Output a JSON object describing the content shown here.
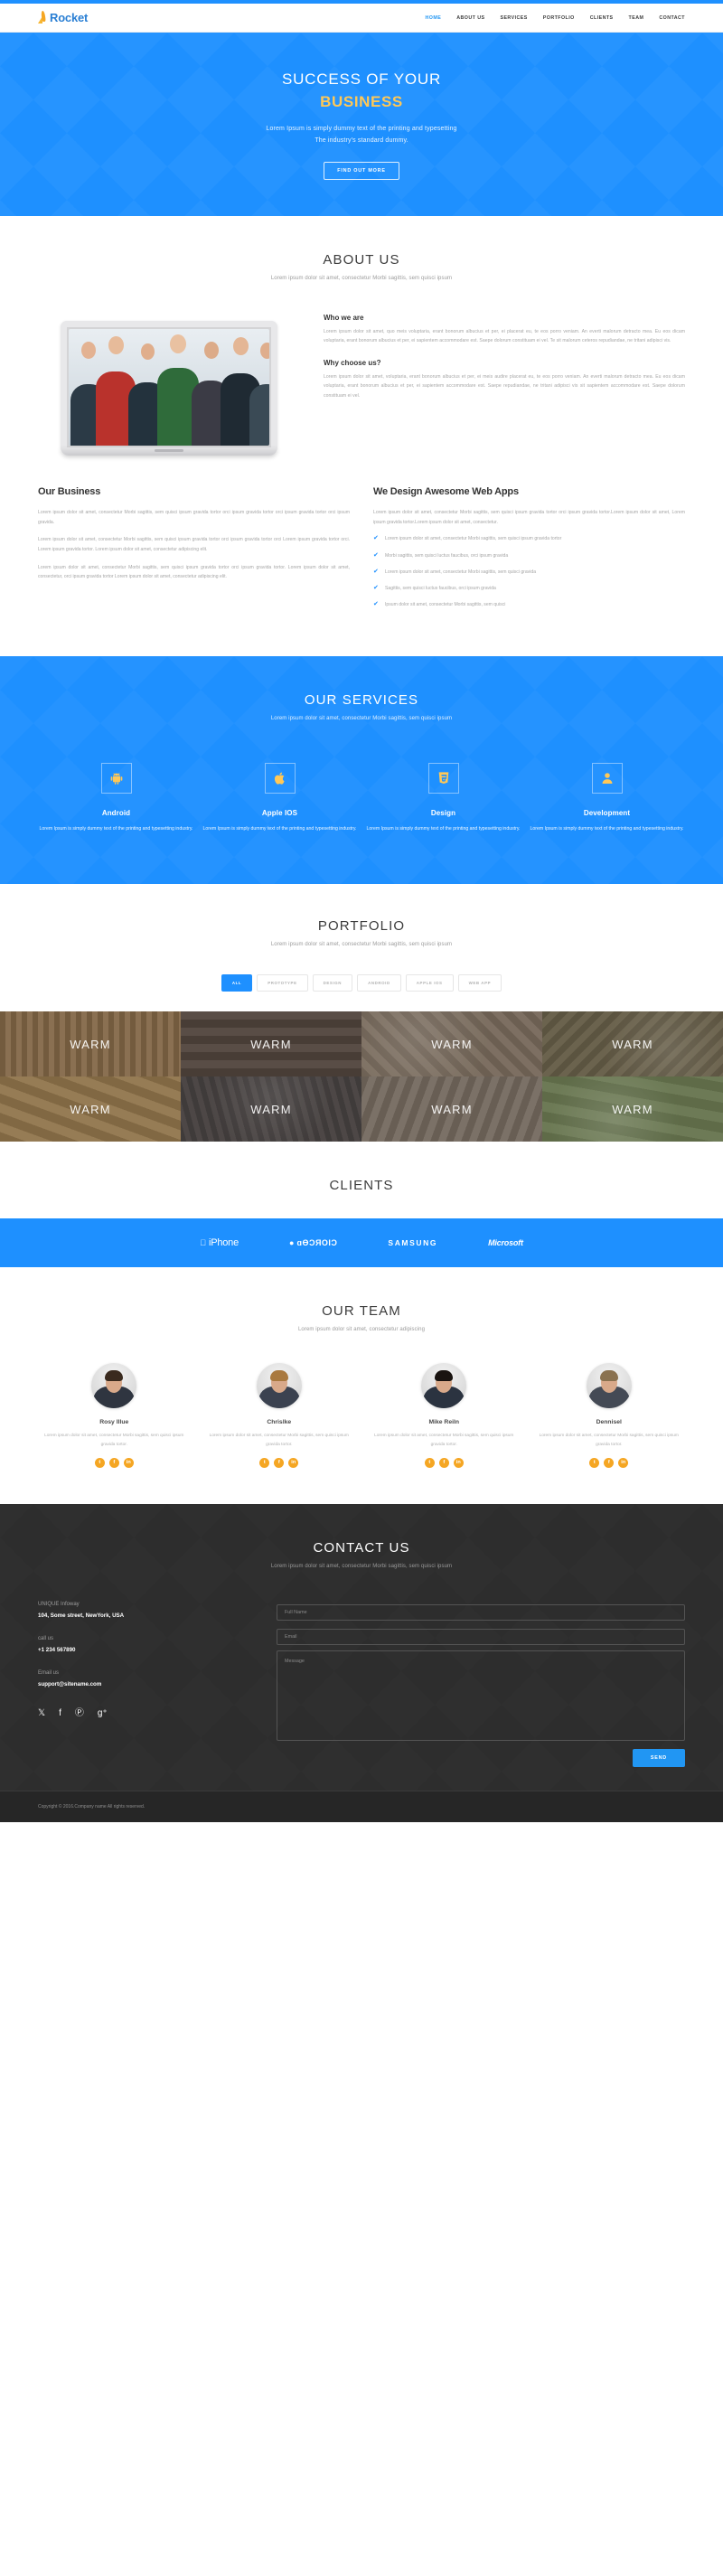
{
  "brand": {
    "name": "Rocket",
    "icon": "rocket-icon"
  },
  "nav": {
    "items": [
      {
        "label": "HOME",
        "active": true
      },
      {
        "label": "ABOUT US",
        "active": false
      },
      {
        "label": "SERVICES",
        "active": false
      },
      {
        "label": "PORTFOLIO",
        "active": false
      },
      {
        "label": "CLIENTS",
        "active": false
      },
      {
        "label": "TEAM",
        "active": false
      },
      {
        "label": "CONTACT",
        "active": false
      }
    ]
  },
  "hero": {
    "title_line1": "SUCCESS OF YOUR",
    "title_line2": "BUSINESS",
    "paragraph_line1": "Lorem Ipsum is simply dummy text of the printing and typesetting",
    "paragraph_line2": "The industry's standard dummy.",
    "button_label": "FIND OUT MORE",
    "bg_color": "#1e90ff",
    "accent_color": "#ffc857"
  },
  "about": {
    "title": "ABOUT US",
    "subtitle": "Lorem ipsum dolor sit amet, consectetur Morbi sagittis, sem quisci ipsum",
    "who_heading": "Who we are",
    "who_text": "Lorem ipsum dolor sit amet, quo meis voluptaria, erant bonorum albucius et per, ei placerat eu, te eos porro veniam. An everti malorum detracto mea. Eu eos dicam voluptaria, erant bonorum albucius et per, ei sapientem accommodare est. Saepe dolorum constituam ei vel. Te sit malorum ceteros repudiandae, ne tritani adipisci vis.",
    "why_heading": "Why choose us?",
    "why_text": "Lorem ipsum dolor sit amet, voluptaria, erant bonorum albucius et per, ei meis audire placerat eu, te eos porro veniam. An everti malorum detracto mea. Eu eos dicam voluptaria, erant bonorum albucius et per, ei sapientem accommodare est. Saepe repudiandae, ne tritani adipisci vis sit sapientem accommodare est. Saepe dolorum constituam ei vel.",
    "left_col": {
      "heading": "Our Business",
      "paragraphs": [
        "Lorem ipsum dolor sit amet, consectetur Morbi sagittis, sem quisci ipsum gravida tortor orci ipsum gravida tortor orci ipsum gravida tortor orci ipsum gravida.",
        "Lorem ipsum dolor sit amet, consectetur Morbi sagittis, sem quisci ipsum gravida tortor orci ipsum gravida tortor orci Lorem ipsum gravida tortor orci. Lorem ipsum gravida tortor. Lorem ipsum dolor sit amet, consectetur adipiscing elit.",
        "Lorem ipsum dolor sit amet, consectetur Morbi sagittis, sem quisci ipsum gravida tortor orci ipsum gravida tortor. Lorem ipsum dolor sit amet, consectetur, orci ipsum gravida tortor Lorem ipsum dolor sit amet, consectetur adipiscing elit."
      ]
    },
    "right_col": {
      "heading": "We Design Awesome Web Apps",
      "paragraphs": [
        "Lorem ipsum dolor sit amet, consectetur Morbi sagittis, sem quisci ipsum gravida tortor orci ipsum gravida tortor.Lorem ipsum dolor sit amet, Lorem ipsum gravida tortor.Lorem ipsum dolor sit amet, consectetur."
      ],
      "checklist": [
        "Lorem ipsum dolor sit amet, consectetur Morbi sagittis, sem quisci ipsum gravida tortor",
        "Morbi sagittis, sem quisci luctus faucibus, orci ipsum gravida",
        "Lorem ipsum dolor sit amet, consectetur Morbi sagittis, sem quisci gravida",
        "Sagittis, sem quisci luctus faucibus, orci ipsum gravida",
        "Ipsum dolor sit amet, consectetur Morbi sagittis, sem quisci"
      ]
    }
  },
  "services": {
    "title": "OUR SERVICES",
    "subtitle": "Lorem ipsum dolor sit amet, consectetur Morbi sagittis, sem quisci ipsum",
    "items": [
      {
        "icon": "android-icon",
        "glyph": "●",
        "title": "Android",
        "text": "Lorem Ipsum is simply dummy text of the printing and typesetting industry."
      },
      {
        "icon": "apple-icon",
        "glyph": "",
        "title": "Apple IOS",
        "text": "Lorem Ipsum is simply dummy text of the printing and typesetting industry."
      },
      {
        "icon": "html5-icon",
        "glyph": "5",
        "title": "Design",
        "text": "Lorem Ipsum is simply dummy text of the printing and typesetting industry."
      },
      {
        "icon": "user-icon",
        "glyph": "●",
        "title": "Development",
        "text": "Lorem Ipsum is simply dummy text of the printing and typesetting industry."
      }
    ]
  },
  "portfolio": {
    "title": "PORTFOLIO",
    "subtitle": "Lorem ipsum dolor sit amet, consectetur Morbi sagittis, sem quisci ipsum",
    "filters": [
      {
        "label": "ALL",
        "active": true
      },
      {
        "label": "PROTOTYPE",
        "active": false
      },
      {
        "label": "DESIGN",
        "active": false
      },
      {
        "label": "ANDROID",
        "active": false
      },
      {
        "label": "APPLE IOS",
        "active": false
      },
      {
        "label": "WEB APP",
        "active": false
      }
    ],
    "tiles": [
      {
        "caption": "WARM",
        "tint": "rgba(120,90,55,0.40)",
        "base": "#8a7152"
      },
      {
        "caption": "WARM",
        "tint": "rgba(70,58,50,0.45)",
        "base": "#5d5149"
      },
      {
        "caption": "WARM",
        "tint": "rgba(110,95,80,0.40)",
        "base": "#7d7062"
      },
      {
        "caption": "WARM",
        "tint": "rgba(90,80,60,0.40)",
        "base": "#6f6750"
      },
      {
        "caption": "WARM",
        "tint": "rgba(130,100,60,0.38)",
        "base": "#9a8055"
      },
      {
        "caption": "WARM",
        "tint": "rgba(60,55,55,0.45)",
        "base": "#524c4a"
      },
      {
        "caption": "WARM",
        "tint": "rgba(105,95,85,0.40)",
        "base": "#7a6f63"
      },
      {
        "caption": "WARM",
        "tint": "rgba(95,110,70,0.40)",
        "base": "#6d7a55"
      }
    ]
  },
  "clients": {
    "title": "CLIENTS",
    "logos": [
      {
        "name": "apple-iphone-logo",
        "text": "iPhone",
        "style": "lg-iphone",
        "prefix": ""
      },
      {
        "name": "android-logo",
        "text": "ɑƟƆЯОIƆ",
        "style": "lg-android",
        "prefix": ""
      },
      {
        "name": "samsung-logo",
        "text": "SAMSUNG",
        "style": "lg-samsung",
        "prefix": ""
      },
      {
        "name": "microsoft-logo",
        "text": "Microsoft",
        "style": "lg-ms",
        "prefix": ""
      }
    ]
  },
  "team": {
    "title": "OUR TEAM",
    "subtitle": "Lorem ipsum dolor sit amet, consectetur adipiscing",
    "members": [
      {
        "name": "Rosy Illue",
        "bio": "Lorem ipsum dolor sit amet, consectetur Morbi sagittis, sem quisci ipsum gravida tortor.",
        "hair": "#3a2a1e",
        "suit": "#2f3540"
      },
      {
        "name": "Chrislke",
        "bio": "Lorem ipsum dolor sit amet, consectetur Morbi sagittis, sem quisci ipsum gravida tortor.",
        "hair": "#a9793f",
        "suit": "#3b4250"
      },
      {
        "name": "Mike Reiln",
        "bio": "Lorem ipsum dolor sit amet, consectetur Morbi sagittis, sem quisci ipsum gravida tortor.",
        "hair": "#191310",
        "suit": "#2b3340"
      },
      {
        "name": "Dennisel",
        "bio": "Lorem ipsum dolor sit amet, consectetur Morbi sagittis, sem quisci ipsum gravida tortor.",
        "hair": "#8a7250",
        "suit": "#444a55"
      }
    ],
    "socials": [
      {
        "name": "twitter-icon",
        "glyph": "t"
      },
      {
        "name": "facebook-icon",
        "glyph": "f"
      },
      {
        "name": "linkedin-icon",
        "glyph": "in"
      }
    ]
  },
  "contact": {
    "title": "CONTACT US",
    "subtitle": "Lorem ipsum dolor sit amet, consectetur Morbi sagittis, sem quisci ipsum",
    "company_label": "UNIQUE Infoway",
    "address": "104, Some street, NewYork, USA",
    "call_label": "call us",
    "phone": "+1 234 567890",
    "email_label": "Email us",
    "email": "support@sitename.com",
    "socials": [
      {
        "name": "twitter-icon",
        "glyph": "𝕏"
      },
      {
        "name": "facebook-icon",
        "glyph": "f"
      },
      {
        "name": "pinterest-icon",
        "glyph": "Ⓟ"
      },
      {
        "name": "google-plus-icon",
        "glyph": "g⁺"
      }
    ],
    "form": {
      "name_placeholder": "Full Name",
      "name_value": "",
      "email_placeholder": "Email",
      "email_value": "",
      "message_placeholder": "Message",
      "message_value": "",
      "submit_label": "SEND"
    }
  },
  "footer": {
    "copyright": "Copyright © 2016.Company name All rights reserved."
  }
}
